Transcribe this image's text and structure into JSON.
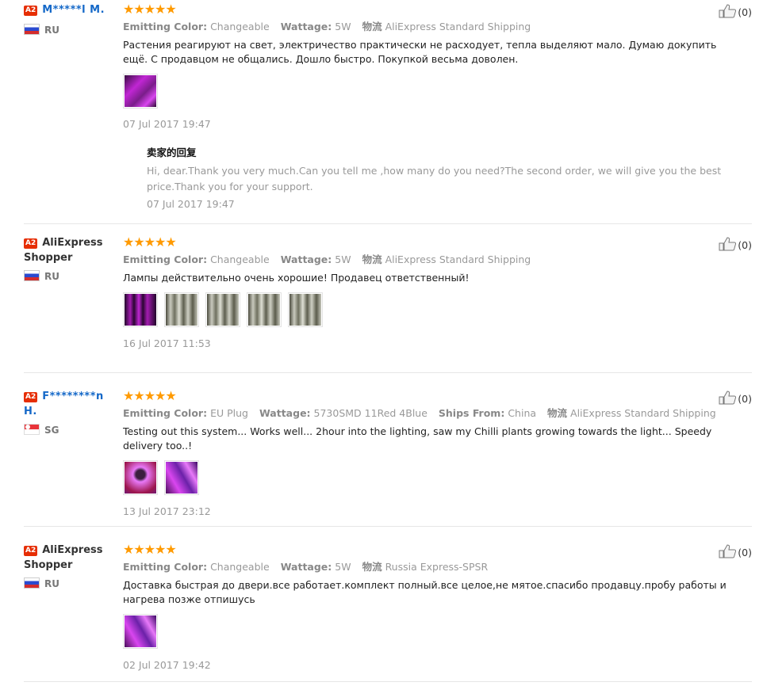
{
  "labels": {
    "emitting_color": "Emitting Color:",
    "wattage": "Wattage:",
    "ships_from": "Ships From:",
    "logistics": "物流",
    "seller_reply": "卖家的回复",
    "stars": "★★★★★"
  },
  "reviews": [
    {
      "badge": "A2",
      "name": "M*****l M.",
      "country": "RU",
      "emitting_color": "Changeable",
      "wattage": "5W",
      "logistics": "AliExpress Standard Shipping",
      "text": "Растения реагируют на свет, электричество практически не расходует, тепла выделяют мало. Думаю докупить ещё. С продавцом не общались. Дошло быстро. Покупкой весьма доволен.",
      "date": "07 Jul 2017 19:47",
      "reply_text": "Hi, dear.Thank you very much.Can you tell me ,how many do you need?The second order, we will give you the best price.Thank you for your support.",
      "reply_date": "07 Jul 2017 19:47",
      "useful_count": "(0)"
    },
    {
      "badge": "A2",
      "name": "AliExpress Shopper",
      "country": "RU",
      "emitting_color": "Changeable",
      "wattage": "5W",
      "logistics": "AliExpress Standard Shipping",
      "text": "Лампы действительно очень хорошие! Продавец ответственный!",
      "date": "16 Jul 2017 11:53",
      "useful_count": "(0)"
    },
    {
      "badge": "A2",
      "name": "F********n H.",
      "country": "SG",
      "emitting_color": "EU Plug",
      "wattage": "5730SMD 11Red 4Blue",
      "ships_from": "China",
      "logistics": "AliExpress Standard Shipping",
      "text": "Testing out this system... Works well... 2hour into the lighting, saw my Chilli plants growing towards the light... Speedy delivery too..!",
      "date": "13 Jul 2017 23:12",
      "useful_count": "(0)"
    },
    {
      "badge": "A2",
      "name": "AliExpress Shopper",
      "country": "RU",
      "emitting_color": "Changeable",
      "wattage": "5W",
      "logistics": "Russia Express-SPSR",
      "text": "Доставка быстрая до двери.все работает.комплект полный.все целое,не мятое.спасибо продавцу.пробу работы и нагрева позже отпишусь",
      "date": "02 Jul 2017 19:42",
      "useful_count": "(0)"
    }
  ],
  "colors": {
    "star": "#ff9a00",
    "badge": "#e62e04",
    "link": "#1468c8"
  },
  "icons": [
    "thumbs-up-icon",
    "flag-ru-icon",
    "flag-sg-icon",
    "star-icon"
  ]
}
